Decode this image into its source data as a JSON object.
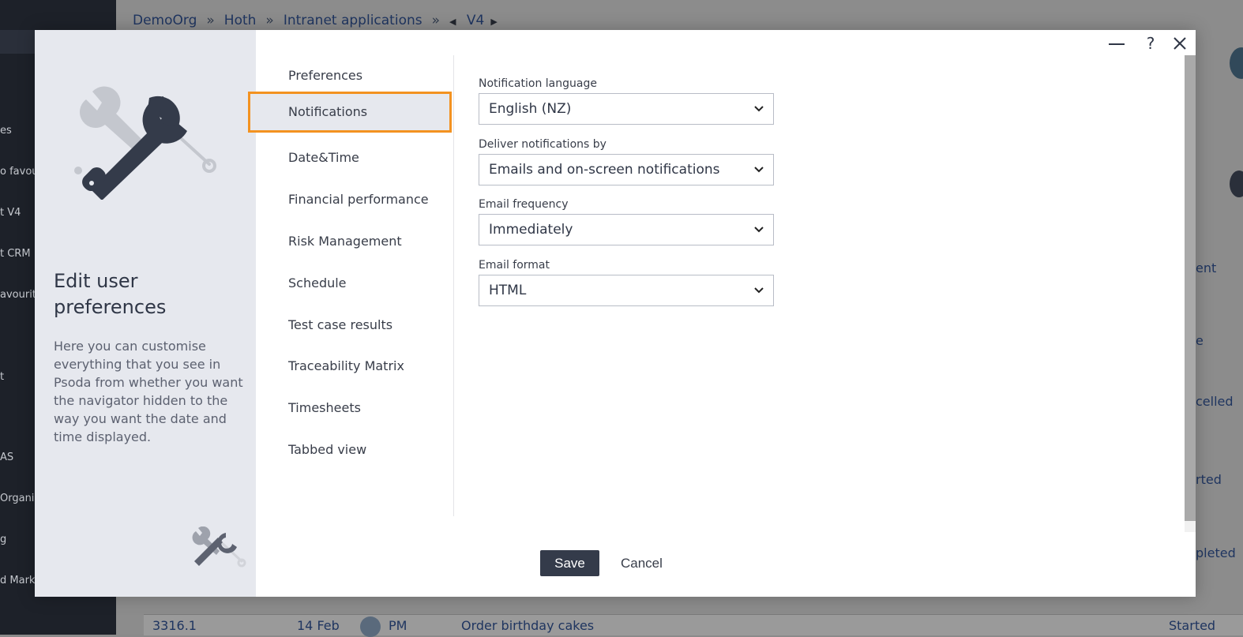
{
  "background": {
    "breadcrumb": [
      "DemoOrg",
      "Hoth",
      "Intranet applications",
      "V4"
    ],
    "breadcrumb_separator": "»",
    "sidebar_fragments": [
      "es",
      "o favour",
      "t V4",
      "t CRM",
      "avourite",
      "t",
      "AS",
      "Organis",
      "g",
      "d Mark"
    ],
    "right_fragments": [
      "ent",
      "e",
      "celled",
      "rted",
      "pleted"
    ],
    "table_row": {
      "id": "3316.1",
      "date": "14 Feb",
      "initials": "PM",
      "task": "Order birthday cakes",
      "status": "Started"
    }
  },
  "modal": {
    "title": "Edit user preferences",
    "description": "Here you can customise everything that you see in Psoda from whether you want the navigator hidden to the way you want the date and time displayed.",
    "nav": [
      {
        "label": "Preferences",
        "active": false
      },
      {
        "label": "Notifications",
        "active": true
      },
      {
        "label": "Date&Time",
        "active": false
      },
      {
        "label": "Financial performance",
        "active": false
      },
      {
        "label": "Risk Management",
        "active": false
      },
      {
        "label": "Schedule",
        "active": false
      },
      {
        "label": "Test case results",
        "active": false
      },
      {
        "label": "Traceability Matrix",
        "active": false
      },
      {
        "label": "Timesheets",
        "active": false
      },
      {
        "label": "Tabbed view",
        "active": false
      }
    ],
    "fields": {
      "language": {
        "label": "Notification language",
        "value": "English (NZ)"
      },
      "deliver": {
        "label": "Deliver notifications by",
        "value": "Emails and on-screen notifications"
      },
      "frequency": {
        "label": "Email frequency",
        "value": "Immediately"
      },
      "format": {
        "label": "Email format",
        "value": "HTML"
      }
    },
    "buttons": {
      "save": "Save",
      "cancel": "Cancel"
    },
    "help": "?",
    "colors": {
      "highlight": "#f39220",
      "primary": "#343b4a",
      "panel": "#e6e8ee"
    }
  }
}
